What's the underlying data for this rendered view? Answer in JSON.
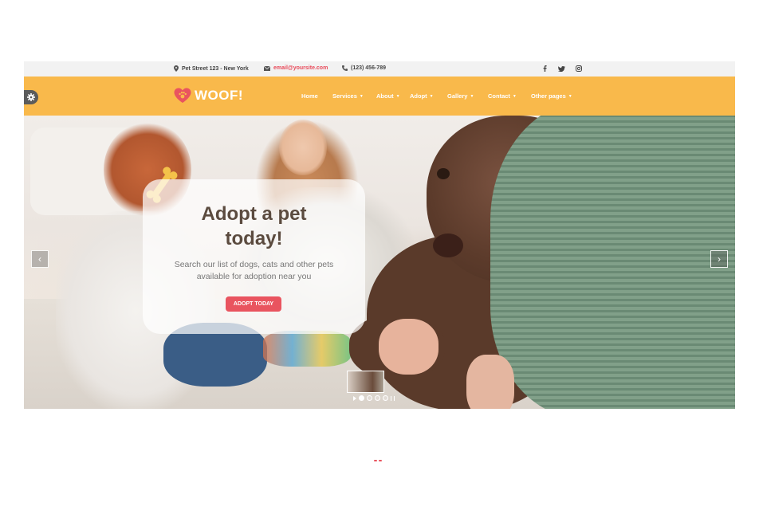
{
  "topbar": {
    "address": "Pet Street 123 - New York",
    "email": "email@yoursite.com",
    "phone": "(123) 456-789",
    "address_icon": "map-marker-icon",
    "email_icon": "envelope-icon",
    "phone_icon": "phone-icon",
    "social_icons": [
      "facebook-icon",
      "twitter-icon",
      "instagram-icon"
    ]
  },
  "navbar": {
    "brand": "WOOF!",
    "settings_icon": "gear-icon",
    "menu": [
      {
        "label": "Home",
        "dropdown": false
      },
      {
        "label": "Services",
        "dropdown": true
      },
      {
        "label": "About",
        "dropdown": true
      },
      {
        "label": "Adopt",
        "dropdown": true
      },
      {
        "label": "Gallery",
        "dropdown": true
      },
      {
        "label": "Contact",
        "dropdown": true
      },
      {
        "label": "Other pages",
        "dropdown": true
      }
    ]
  },
  "hero": {
    "title_line1": "Adopt a pet",
    "title_line2": "today!",
    "subtitle_line1": "Search our list of dogs, cats and other pets",
    "subtitle_line2": "available for adoption near you",
    "cta": "ADOPT TODAY",
    "prev_arrow": "‹",
    "next_arrow": "›",
    "slide_count": 4,
    "active_slide": 1
  },
  "colors": {
    "brand_yellow": "#f9b94b",
    "accent_red": "#e9545f",
    "topbar_bg": "#f2f2f2"
  }
}
